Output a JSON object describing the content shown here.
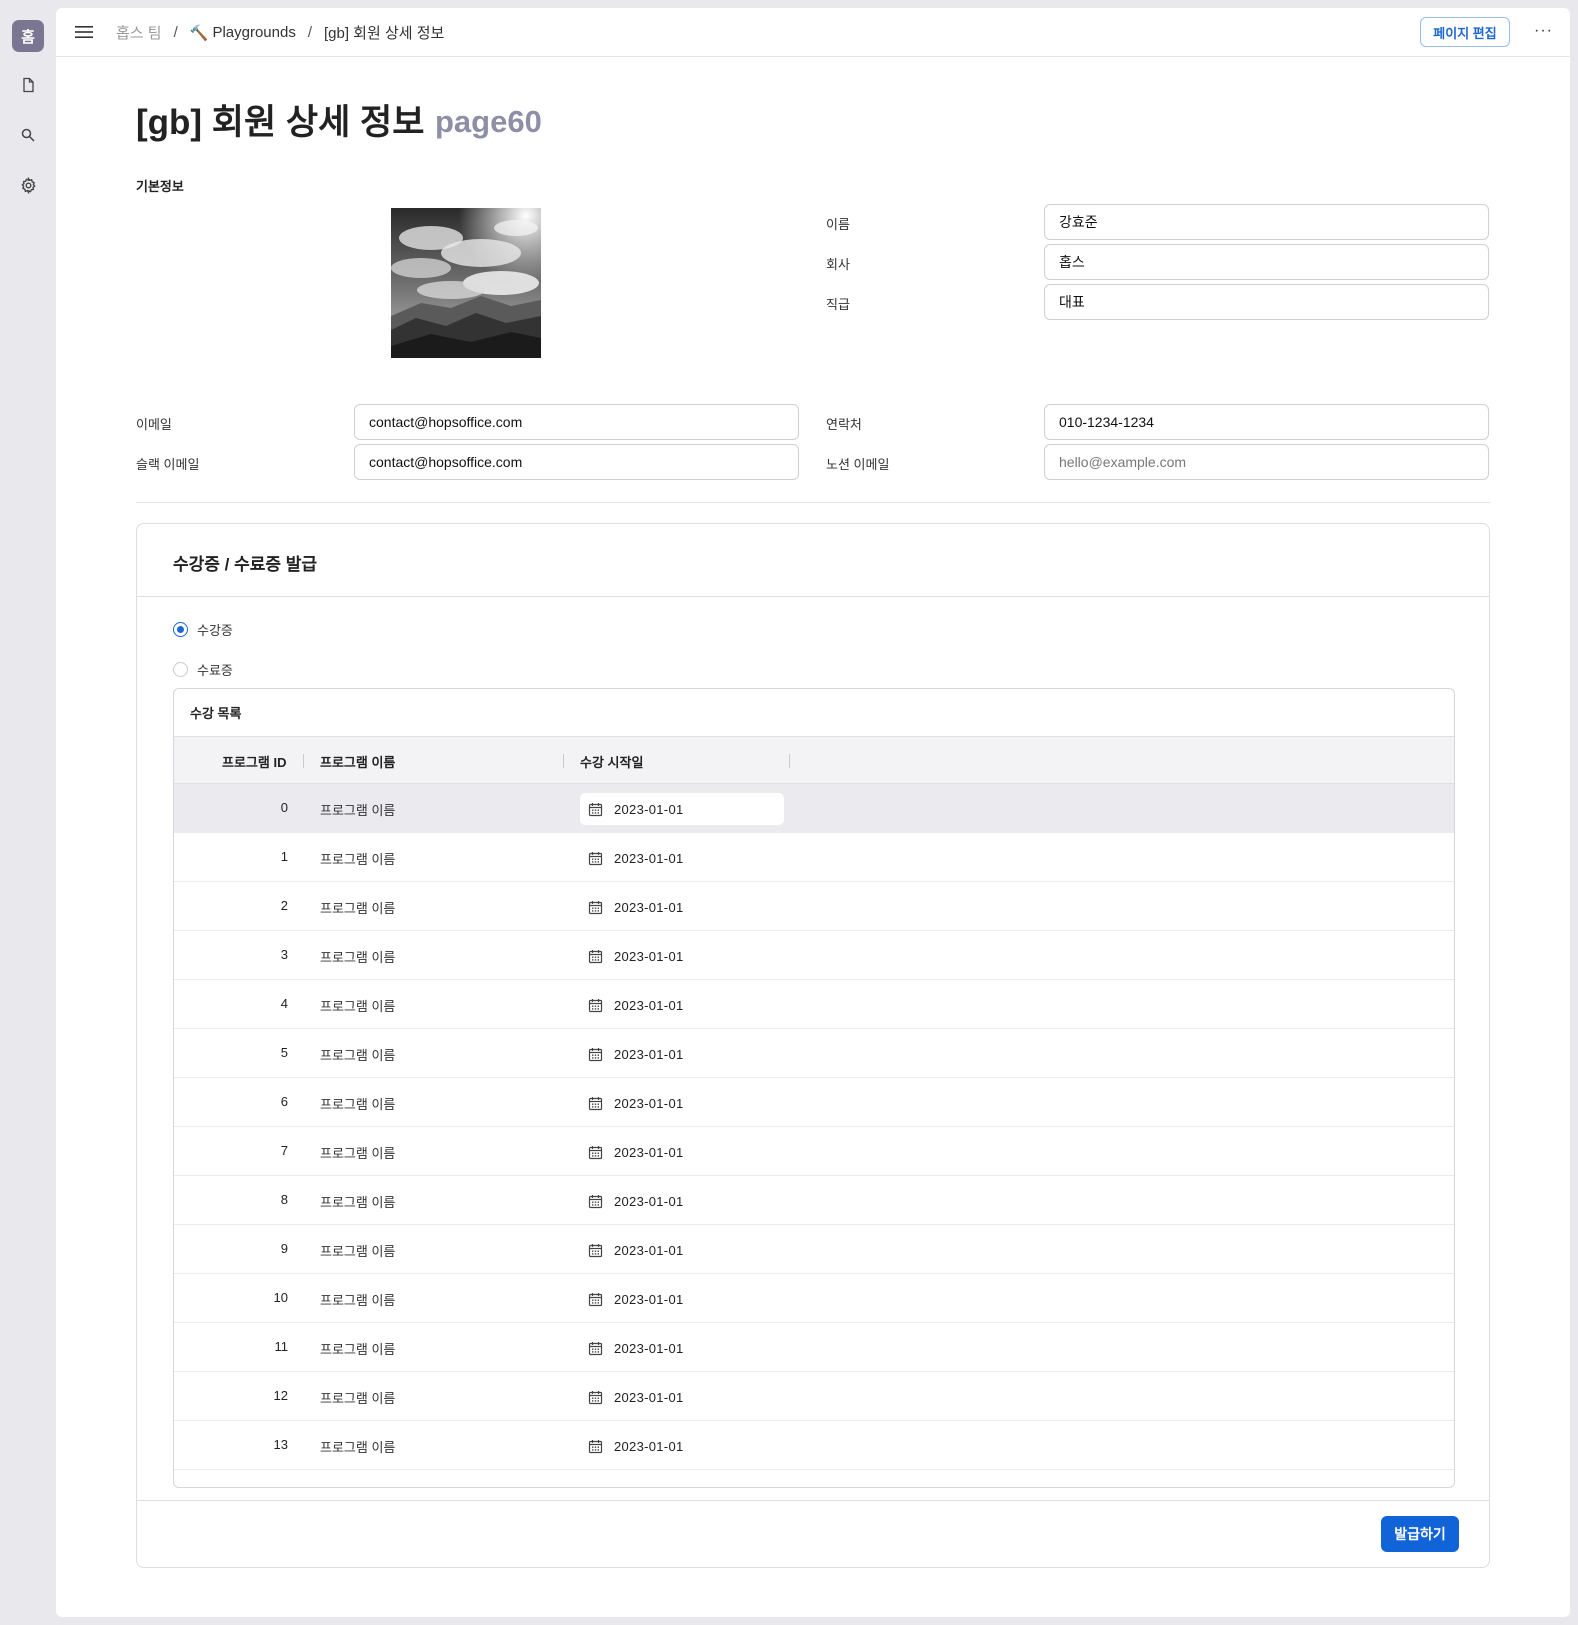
{
  "rail": {
    "home_label": "홈"
  },
  "header": {
    "breadcrumb": [
      "홉스 팀",
      "Playgrounds",
      "[gb] 회원 상세 정보"
    ],
    "hammer_emoji": "🔨",
    "edit_button": "페이지 편집",
    "more_button": "···"
  },
  "page": {
    "title": "[gb] 회원 상세 정보",
    "subtitle": "page60",
    "section_label": "기본정보"
  },
  "profile": {
    "fields": [
      {
        "label": "이름",
        "value": "강효준"
      },
      {
        "label": "회사",
        "value": "홉스"
      },
      {
        "label": "직급",
        "value": "대표"
      }
    ]
  },
  "contact": {
    "email_label": "이메일",
    "email_value": "contact@hopsoffice.com",
    "slack_label": "슬랙 이메일",
    "slack_value": "contact@hopsoffice.com",
    "phone_label": "연락처",
    "phone_value": "010-1234-1234",
    "notion_label": "노션 이메일",
    "notion_placeholder": "hello@example.com"
  },
  "certificate": {
    "title": "수강증 / 수료증 발급",
    "options": [
      {
        "label": "수강증",
        "selected": true
      },
      {
        "label": "수료증",
        "selected": false
      }
    ],
    "issue_button": "발급하기",
    "table": {
      "caption": "수강 목록",
      "columns": [
        "프로그램 ID",
        "프로그램 이름",
        "수강 시작일"
      ],
      "rows": [
        {
          "id": "0",
          "name": "프로그램 이름",
          "start": "2023-01-01"
        },
        {
          "id": "1",
          "name": "프로그램 이름",
          "start": "2023-01-01"
        },
        {
          "id": "2",
          "name": "프로그램 이름",
          "start": "2023-01-01"
        },
        {
          "id": "3",
          "name": "프로그램 이름",
          "start": "2023-01-01"
        },
        {
          "id": "4",
          "name": "프로그램 이름",
          "start": "2023-01-01"
        },
        {
          "id": "5",
          "name": "프로그램 이름",
          "start": "2023-01-01"
        },
        {
          "id": "6",
          "name": "프로그램 이름",
          "start": "2023-01-01"
        },
        {
          "id": "7",
          "name": "프로그램 이름",
          "start": "2023-01-01"
        },
        {
          "id": "8",
          "name": "프로그램 이름",
          "start": "2023-01-01"
        },
        {
          "id": "9",
          "name": "프로그램 이름",
          "start": "2023-01-01"
        },
        {
          "id": "10",
          "name": "프로그램 이름",
          "start": "2023-01-01"
        },
        {
          "id": "11",
          "name": "프로그램 이름",
          "start": "2023-01-01"
        },
        {
          "id": "12",
          "name": "프로그램 이름",
          "start": "2023-01-01"
        },
        {
          "id": "13",
          "name": "프로그램 이름",
          "start": "2023-01-01"
        }
      ]
    }
  },
  "colors": {
    "accent": "#1164d8",
    "rail_home": "#7a7590",
    "subtitle": "#8e8ea6",
    "selected_row": "#ebebef"
  }
}
